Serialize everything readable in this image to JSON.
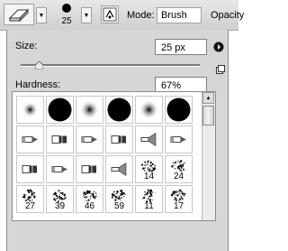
{
  "toolbar": {
    "tool_icon": "eraser-icon",
    "brush_size_label": "25",
    "mode_label": "Mode:",
    "mode_value": "Brush",
    "opacity_label": "Opacity"
  },
  "panel": {
    "size_label": "Size:",
    "size_value": "25 px",
    "size_level_percent": 10,
    "hardness_label": "Hardness:",
    "hardness_value": "67%",
    "hardness_level_percent": 67,
    "menu_icon": "panel-menu-arrow-icon",
    "new_preset_icon": "new-preset-icon"
  },
  "presets": [
    {
      "kind": "soft",
      "r": 9,
      "label": ""
    },
    {
      "kind": "hard",
      "r": 13,
      "label": ""
    },
    {
      "kind": "soft",
      "r": 11,
      "label": ""
    },
    {
      "kind": "hard",
      "r": 13,
      "label": ""
    },
    {
      "kind": "soft",
      "r": 11,
      "label": ""
    },
    {
      "kind": "hard",
      "r": 13,
      "label": ""
    },
    {
      "kind": "pencil",
      "label": ""
    },
    {
      "kind": "flat",
      "label": ""
    },
    {
      "kind": "pencil",
      "label": ""
    },
    {
      "kind": "flat",
      "label": ""
    },
    {
      "kind": "fan",
      "label": ""
    },
    {
      "kind": "chisel",
      "label": ""
    },
    {
      "kind": "flat",
      "label": ""
    },
    {
      "kind": "chisel",
      "label": ""
    },
    {
      "kind": "flat",
      "label": ""
    },
    {
      "kind": "fan",
      "label": ""
    },
    {
      "kind": "spatter",
      "label": "14"
    },
    {
      "kind": "spatter",
      "label": "24"
    },
    {
      "kind": "spatter",
      "label": "27"
    },
    {
      "kind": "spatter",
      "label": "39"
    },
    {
      "kind": "spatter",
      "label": "46"
    },
    {
      "kind": "spatter",
      "label": "59"
    },
    {
      "kind": "spatter",
      "label": "11"
    },
    {
      "kind": "spatter",
      "label": "17"
    }
  ]
}
